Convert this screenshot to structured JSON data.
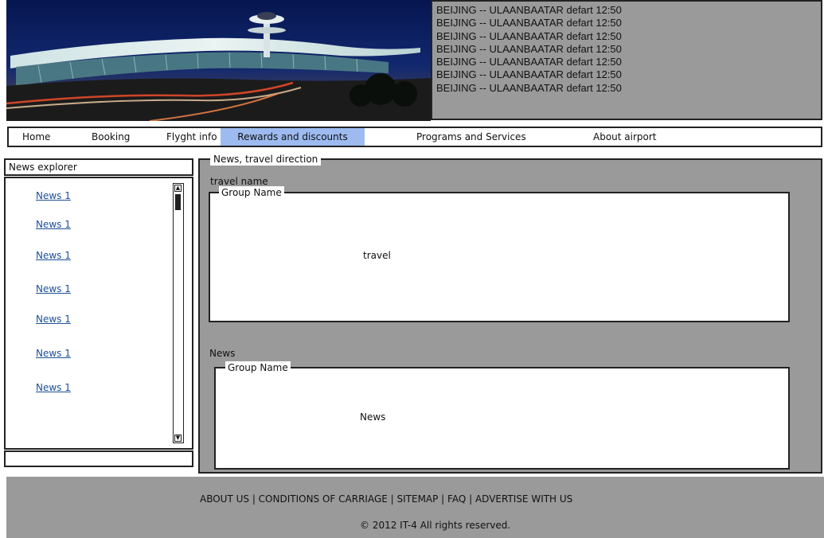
{
  "header": {
    "hero_image_alt": "airport terminal at night",
    "flights": [
      "BEIJING -- ULAANBAATAR defart 12:50",
      "BEIJING -- ULAANBAATAR defart 12:50",
      "BEIJING -- ULAANBAATAR defart 12:50",
      "BEIJING -- ULAANBAATAR defart 12:50",
      "BEIJING -- ULAANBAATAR defart 12:50",
      "BEIJING -- ULAANBAATAR defart 12:50",
      "BEIJING -- ULAANBAATAR defart 12:50"
    ]
  },
  "nav": {
    "items": [
      {
        "label": "Home"
      },
      {
        "label": "Booking"
      },
      {
        "label": "Flyght info"
      },
      {
        "label": "Rewards and discounts"
      },
      {
        "label": "Programs and Services"
      },
      {
        "label": "About airport"
      }
    ],
    "active_index": 3
  },
  "sidebar": {
    "title": "News explorer",
    "links": [
      {
        "label": "News 1"
      },
      {
        "label": "News 1"
      },
      {
        "label": "News 1"
      },
      {
        "label": "News 1"
      },
      {
        "label": "News 1"
      },
      {
        "label": "News 1"
      },
      {
        "label": "News 1"
      }
    ]
  },
  "main": {
    "legend": "News, travel direction",
    "travel": {
      "label": "travel  name",
      "group_name": "Group Name",
      "content": "travel"
    },
    "news": {
      "label": "News",
      "group_name": "Group Name",
      "content": "News"
    }
  },
  "footer": {
    "links": "ABOUT US | CONDITIONS OF CARRIAGE | SITEMAP | FAQ | ADVERTISE WITH US",
    "copyright": "© 2012 IT-4 All rights reserved."
  },
  "colors": {
    "panel_gray": "#9a9a9a",
    "active_tab": "#9dbbf0",
    "link_blue": "#1d4f96"
  }
}
